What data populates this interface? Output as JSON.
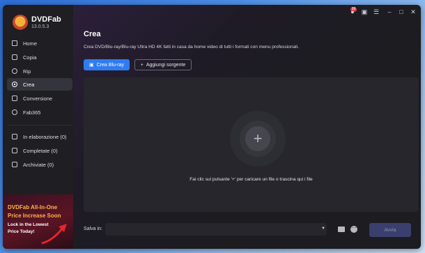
{
  "app": {
    "brand": "DVDFab",
    "version": "13.0.5.3"
  },
  "sidebar": {
    "items": [
      {
        "label": "Home",
        "icon": "home-icon"
      },
      {
        "label": "Copia",
        "icon": "copy-icon"
      },
      {
        "label": "Rip",
        "icon": "rip-icon"
      },
      {
        "label": "Crea",
        "icon": "create-icon",
        "active": true
      },
      {
        "label": "Conversione",
        "icon": "convert-icon"
      },
      {
        "label": "Fab365",
        "icon": "fab365-icon"
      }
    ],
    "tasks": [
      {
        "label": "In elaborazione (0)",
        "icon": "processing-icon"
      },
      {
        "label": "Completate (0)",
        "icon": "completed-icon"
      },
      {
        "label": "Archiviate (0)",
        "icon": "archived-icon"
      }
    ]
  },
  "promo": {
    "line1": "DVDFab All-In-One",
    "line2": "Price Increase Soon",
    "line3": "Lock in the Lowest",
    "line4": "Price Today!"
  },
  "titlebar": {
    "badge": "99",
    "icons": [
      "notification-icon",
      "tray-icon",
      "menu-icon",
      "minimize-icon",
      "maximize-icon",
      "close-icon"
    ]
  },
  "main": {
    "title": "Crea",
    "subtitle": "Crea DVD/Blu-ray/Blu-ray Ultra HD 4K fatti in casa da home video di tutti i formati con menu professionali.",
    "primary_button": "Crea Blu-ray",
    "secondary_button": "Aggiungi sorgente",
    "drop_hint": "Fai clic sul pulsante '+' per caricare un file o trascina qui i file",
    "save_label": "Salva in:",
    "start_button": "Avvia"
  },
  "colors": {
    "accent": "#2f7cf0",
    "promo_text": "#ffb347",
    "background": "#1c1c21"
  }
}
